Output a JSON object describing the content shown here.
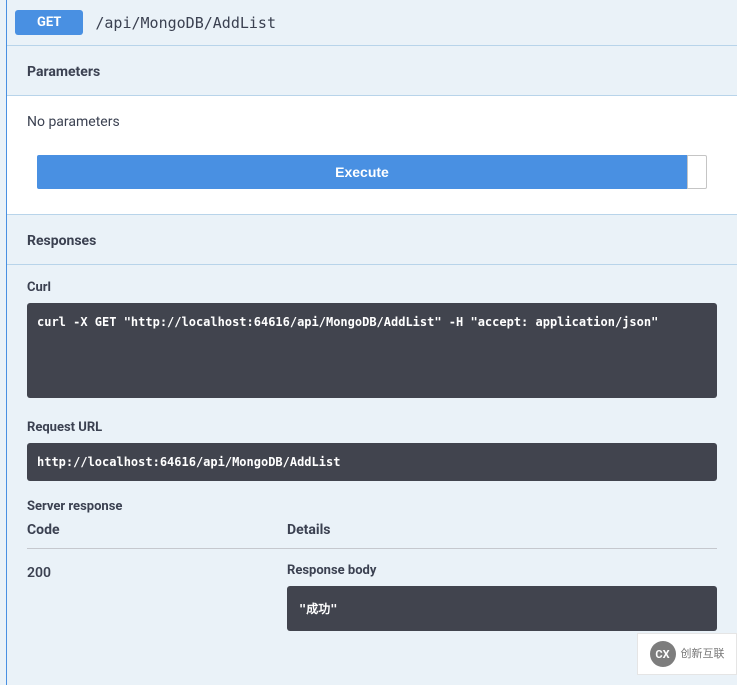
{
  "header": {
    "method": "GET",
    "path": "/api/MongoDB/AddList"
  },
  "parameters": {
    "section_title": "Parameters",
    "no_params_text": "No parameters"
  },
  "execute": {
    "label": "Execute"
  },
  "responses": {
    "section_title": "Responses",
    "curl": {
      "label": "Curl",
      "value": "curl -X GET \"http://localhost:64616/api/MongoDB/AddList\" -H \"accept: application/json\""
    },
    "request_url": {
      "label": "Request URL",
      "value": "http://localhost:64616/api/MongoDB/AddList"
    },
    "server_response": {
      "label": "Server response",
      "columns": {
        "code": "Code",
        "details": "Details"
      },
      "row": {
        "code": "200",
        "response_body_label": "Response body",
        "response_body_value": "\"成功\""
      }
    }
  },
  "watermark": {
    "icon_text": "CX",
    "line1": "创新互联"
  }
}
